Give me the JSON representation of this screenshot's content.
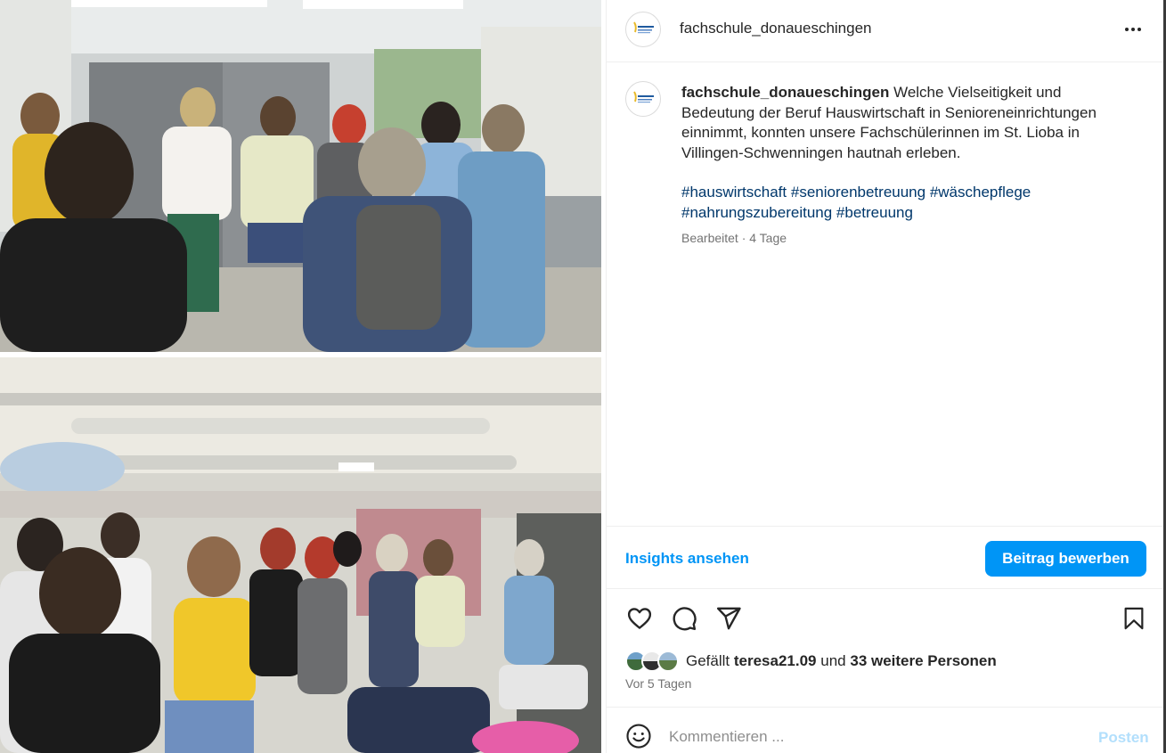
{
  "post": {
    "username": "fachschule_donaueschingen",
    "more_icon": "more-horizontal-icon",
    "caption": {
      "username": "fachschule_donaueschingen",
      "text": "Welche Vielseitigkeit und Bedeutung der Beruf Hauswirtschaft in Senioreneinrichtungen einnimmt, konnten unsere Fachschülerinnen im St. Lioba in Villingen-Schwenningen hautnah erleben.",
      "hashtags": [
        "#hauswirtschaft",
        "#seniorenbetreuung",
        "#wäschepflege",
        "#nahrungszubereitung",
        "#betreuung"
      ],
      "meta": "Bearbeitet · 4 Tage"
    },
    "insights_label": "Insights ansehen",
    "promote_label": "Beitrag bewerben",
    "action_icons": [
      "heart-icon",
      "comment-icon",
      "share-icon",
      "bookmark-icon"
    ],
    "likes": {
      "prefix": "Gefällt",
      "user": "teresa21.09",
      "middle": "und",
      "others": "33 weitere Personen"
    },
    "time": "Vor 5 Tagen",
    "comment": {
      "placeholder": "Kommentieren ...",
      "post_label": "Posten"
    }
  },
  "colors": {
    "accent": "#0095f6",
    "hashtag": "#00376b",
    "muted": "#737373",
    "post_disabled": "#b2dffc"
  }
}
